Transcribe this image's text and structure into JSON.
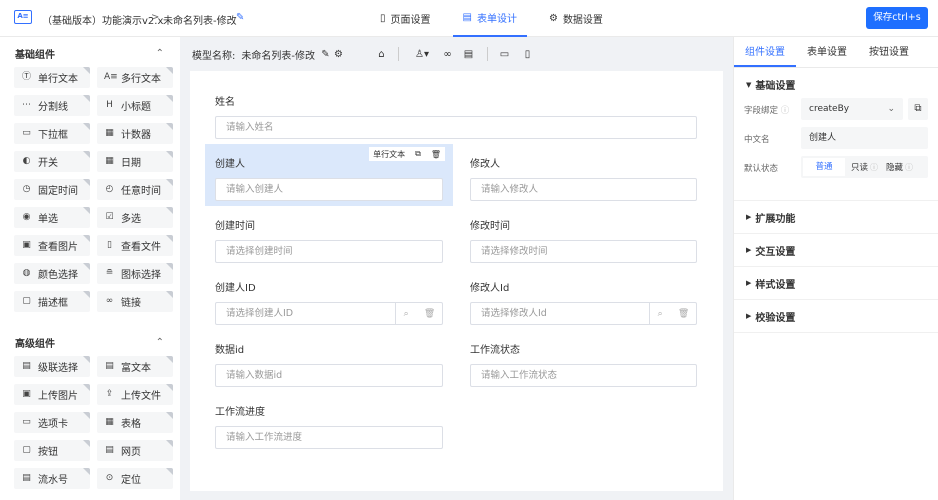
{
  "header": {
    "crumb_app": "（基础版本）功能演示v2.x",
    "crumb_sep": ">",
    "crumb_page": "未命名列表-修改",
    "tabs": [
      {
        "label": "页面设置"
      },
      {
        "label": "表单设计"
      },
      {
        "label": "数据设置"
      }
    ],
    "save_label": "保存ctrl+s"
  },
  "sidebar": {
    "basic_title": "基础组件",
    "basic_items": [
      {
        "label": "单行文本",
        "icon": "text-input-icon"
      },
      {
        "label": "多行文本",
        "icon": "textarea-icon"
      },
      {
        "label": "分割线",
        "icon": "divider-icon"
      },
      {
        "label": "小标题",
        "icon": "heading-icon"
      },
      {
        "label": "下拉框",
        "icon": "dropdown-icon"
      },
      {
        "label": "计数器",
        "icon": "counter-icon"
      },
      {
        "label": "开关",
        "icon": "switch-icon"
      },
      {
        "label": "日期",
        "icon": "calendar-icon"
      },
      {
        "label": "固定时间",
        "icon": "timer-icon"
      },
      {
        "label": "任意时间",
        "icon": "clock-icon"
      },
      {
        "label": "单选",
        "icon": "radio-icon"
      },
      {
        "label": "多选",
        "icon": "checkbox-icon"
      },
      {
        "label": "查看图片",
        "icon": "image-icon"
      },
      {
        "label": "查看文件",
        "icon": "file-icon"
      },
      {
        "label": "颜色选择",
        "icon": "palette-icon"
      },
      {
        "label": "图标选择",
        "icon": "icon-picker-icon"
      },
      {
        "label": "描述框",
        "icon": "description-icon"
      },
      {
        "label": "链接",
        "icon": "link-icon"
      }
    ],
    "advanced_title": "高级组件",
    "advanced_items": [
      {
        "label": "级联选择",
        "icon": "cascade-icon"
      },
      {
        "label": "富文本",
        "icon": "richtext-icon"
      },
      {
        "label": "上传图片",
        "icon": "upload-image-icon"
      },
      {
        "label": "上传文件",
        "icon": "upload-file-icon"
      },
      {
        "label": "选项卡",
        "icon": "tabs-icon"
      },
      {
        "label": "表格",
        "icon": "table-icon"
      },
      {
        "label": "按钮",
        "icon": "button-icon"
      },
      {
        "label": "网页",
        "icon": "webpage-icon"
      },
      {
        "label": "流水号",
        "icon": "serial-icon"
      },
      {
        "label": "定位",
        "icon": "location-icon"
      }
    ]
  },
  "center": {
    "model_label": "模型名称:",
    "model_name": "未命名列表-修改",
    "selected_tag": "单行文本",
    "fields": [
      {
        "label": "姓名",
        "placeholder": "请输入姓名"
      },
      {
        "label": "创建人",
        "placeholder": "请输入创建人"
      },
      {
        "label": "修改人",
        "placeholder": "请输入修改人"
      },
      {
        "label": "创建时间",
        "placeholder": "请选择创建时间"
      },
      {
        "label": "修改时间",
        "placeholder": "请选择修改时间"
      },
      {
        "label": "创建人ID",
        "placeholder": "请选择创建人ID"
      },
      {
        "label": "修改人Id",
        "placeholder": "请选择修改人Id"
      },
      {
        "label": "数据id",
        "placeholder": "请输入数据id"
      },
      {
        "label": "工作流状态",
        "placeholder": "请输入工作流状态"
      },
      {
        "label": "工作流进度",
        "placeholder": "请输入工作流进度"
      }
    ]
  },
  "panel": {
    "tabs": [
      {
        "label": "组件设置"
      },
      {
        "label": "表单设置"
      },
      {
        "label": "按钮设置"
      }
    ],
    "basic_title": "基础设置",
    "field_bind_label": "字段绑定",
    "field_bind_value": "createBy",
    "cn_name_label": "中文名",
    "cn_name_value": "创建人",
    "default_state_label": "默认状态",
    "state_options": [
      "普通",
      "只读",
      "隐藏"
    ],
    "sections": [
      "扩展功能",
      "交互设置",
      "样式设置",
      "校验设置"
    ]
  },
  "colors": {
    "accent": "#3370ff",
    "save": "#1e6fff",
    "selected_bg": "#dbe8fb"
  }
}
